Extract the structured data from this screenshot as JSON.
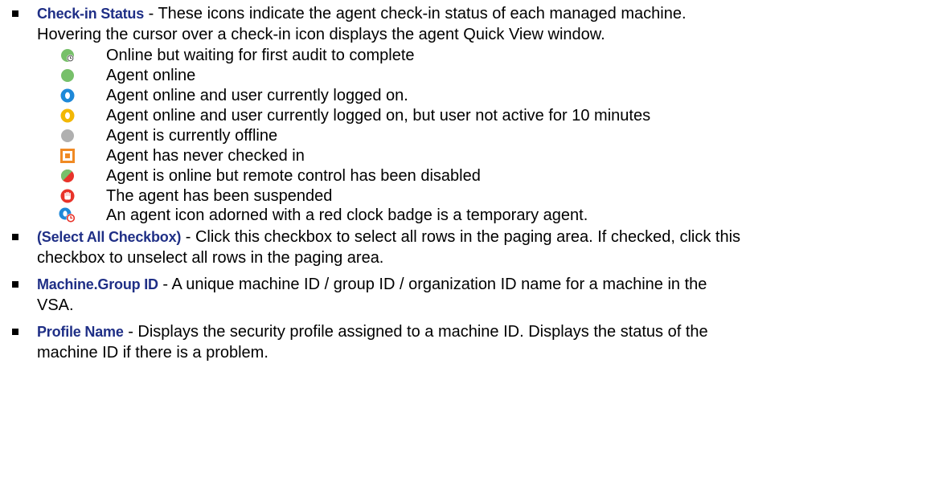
{
  "intro": {
    "term": "Check-in Status",
    "sep": " - ",
    "line1": "These icons indicate the agent check-in status of each managed machine.",
    "line2": "Hovering the cursor over a check-in icon displays the agent Quick View window."
  },
  "statuses": [
    {
      "icon": "green-circle-clock-icon",
      "text": "Online but waiting for first audit to complete"
    },
    {
      "icon": "green-circle-icon",
      "text": "Agent online"
    },
    {
      "icon": "blue-user-circle-icon",
      "text": "Agent online and user currently logged on."
    },
    {
      "icon": "yellow-user-circle-icon",
      "text": "Agent online and user currently logged on, but user not active for 10 minutes"
    },
    {
      "icon": "gray-circle-icon",
      "text": "Agent is currently offline"
    },
    {
      "icon": "orange-square-icon",
      "text": "Agent has never checked in"
    },
    {
      "icon": "green-red-split-circle-icon",
      "text": "Agent is online but remote control has been disabled"
    },
    {
      "icon": "red-hand-circle-icon",
      "text": "The agent has been suspended"
    },
    {
      "icon": "blue-circle-red-clock-badge-icon",
      "text": " An agent icon adorned with a red clock badge is a temporary agent."
    }
  ],
  "items": [
    {
      "term": "(Select All Checkbox)",
      "sep": " - ",
      "line1": "Click this checkbox to select all rows in the paging area. If checked, click this",
      "line2": "checkbox to unselect all rows in the paging area."
    },
    {
      "term": "Machine.Group ID",
      "sep": " - ",
      "line1": "A unique machine ID / group ID / organization ID name for a machine in the",
      "line2": "VSA."
    },
    {
      "term": "Profile Name",
      "sep": " - ",
      "line1": "Displays the security profile assigned to a machine ID. Displays the status of the",
      "line2": "machine ID if there is a problem."
    }
  ],
  "colors": {
    "term": "#1f2f86",
    "green": "#77c06a",
    "blue": "#1e88d8",
    "yellow": "#f2b705",
    "gray": "#b0b0b0",
    "orange": "#f08a24",
    "red": "#e8332a"
  }
}
